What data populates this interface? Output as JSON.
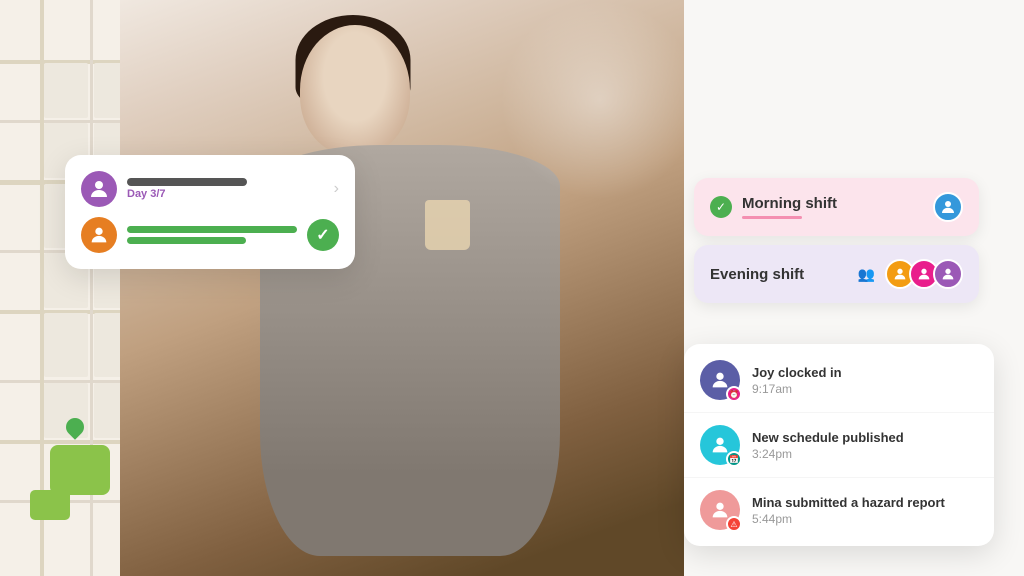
{
  "map": {
    "label": "map-background"
  },
  "checkin_card": {
    "day_label": "Day 3/7",
    "avatar1": "👩",
    "avatar2": "👨"
  },
  "morning_shift": {
    "title": "Morning shift",
    "avatar1": "👨",
    "has_check": true
  },
  "evening_shift": {
    "title": "Evening shift",
    "avatar1": "👱",
    "avatar2": "👩",
    "avatar3": "👩‍🦱"
  },
  "activity": {
    "items": [
      {
        "name": "Joy",
        "action": "Joy clocked in",
        "time": "9:17am",
        "badge": "clock"
      },
      {
        "name": "New",
        "action": "New schedule published",
        "time": "3:24pm",
        "badge": "calendar"
      },
      {
        "name": "Mina",
        "action": "Mina submitted a hazard report",
        "time": "5:44pm",
        "badge": "report"
      }
    ]
  }
}
